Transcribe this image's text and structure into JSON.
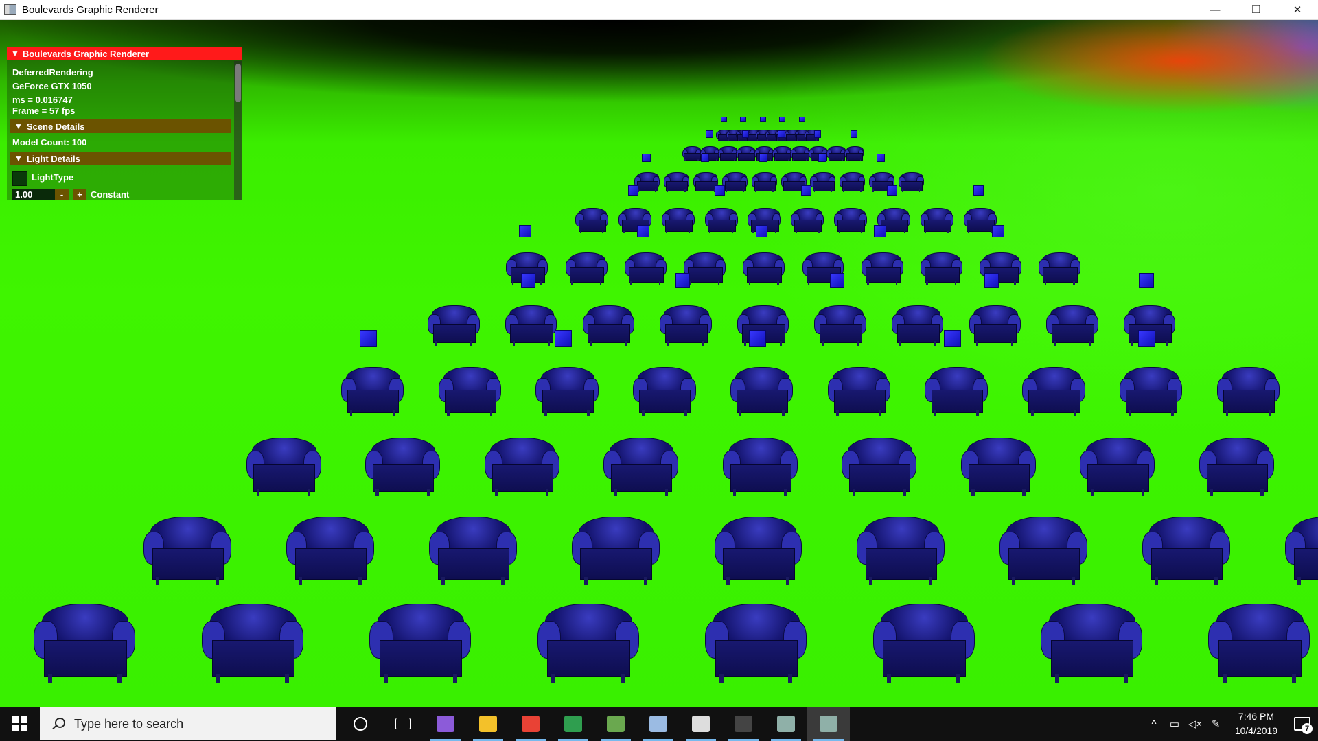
{
  "window": {
    "title": "Boulevards Graphic Renderer",
    "minimize_glyph": "—",
    "restore_glyph": "❐",
    "close_glyph": "✕"
  },
  "panel": {
    "header": "Boulevards Graphic Renderer",
    "mode": "DeferredRendering",
    "gpu": "GeForce GTX 1050",
    "ms": "ms = 0.016747",
    "fps": "Frame = 57 fps",
    "scene_section": "Scene Details",
    "model_count": "Model Count: 100",
    "light_section": "Light Details",
    "light_type": "LightType",
    "constant_value": "1.00",
    "minus": "-",
    "plus": "+",
    "constant_label": "Constant"
  },
  "taskbar": {
    "search_placeholder": "Type here to search",
    "time": "7:46 PM",
    "date": "10/4/2019",
    "notification_count": "7",
    "apps": [
      {
        "name": "cortana-icon",
        "color": "#ffffff"
      },
      {
        "name": "task-view-icon",
        "color": "#ffffff"
      },
      {
        "name": "visual-studio-icon",
        "color": "#8c5bd9"
      },
      {
        "name": "file-explorer-icon",
        "color": "#f3c12a"
      },
      {
        "name": "chrome-icon",
        "color": "#e94235"
      },
      {
        "name": "photos-app-icon",
        "color": "#2f9e4f"
      },
      {
        "name": "paint-image-icon",
        "color": "#6aa84f"
      },
      {
        "name": "paint-3d-icon",
        "color": "#9bbbe3"
      },
      {
        "name": "calculator-icon",
        "color": "#dddddd"
      },
      {
        "name": "terminal-icon",
        "color": "#444444"
      },
      {
        "name": "renderer-window-icon",
        "color": "#8fb0a8"
      },
      {
        "name": "renderer-window-icon-active",
        "color": "#8fb0a8"
      }
    ]
  },
  "scene": {
    "ground_color": "#3ff500",
    "chair_color": "#2d2fb0",
    "cube_color": "#2828f0"
  }
}
